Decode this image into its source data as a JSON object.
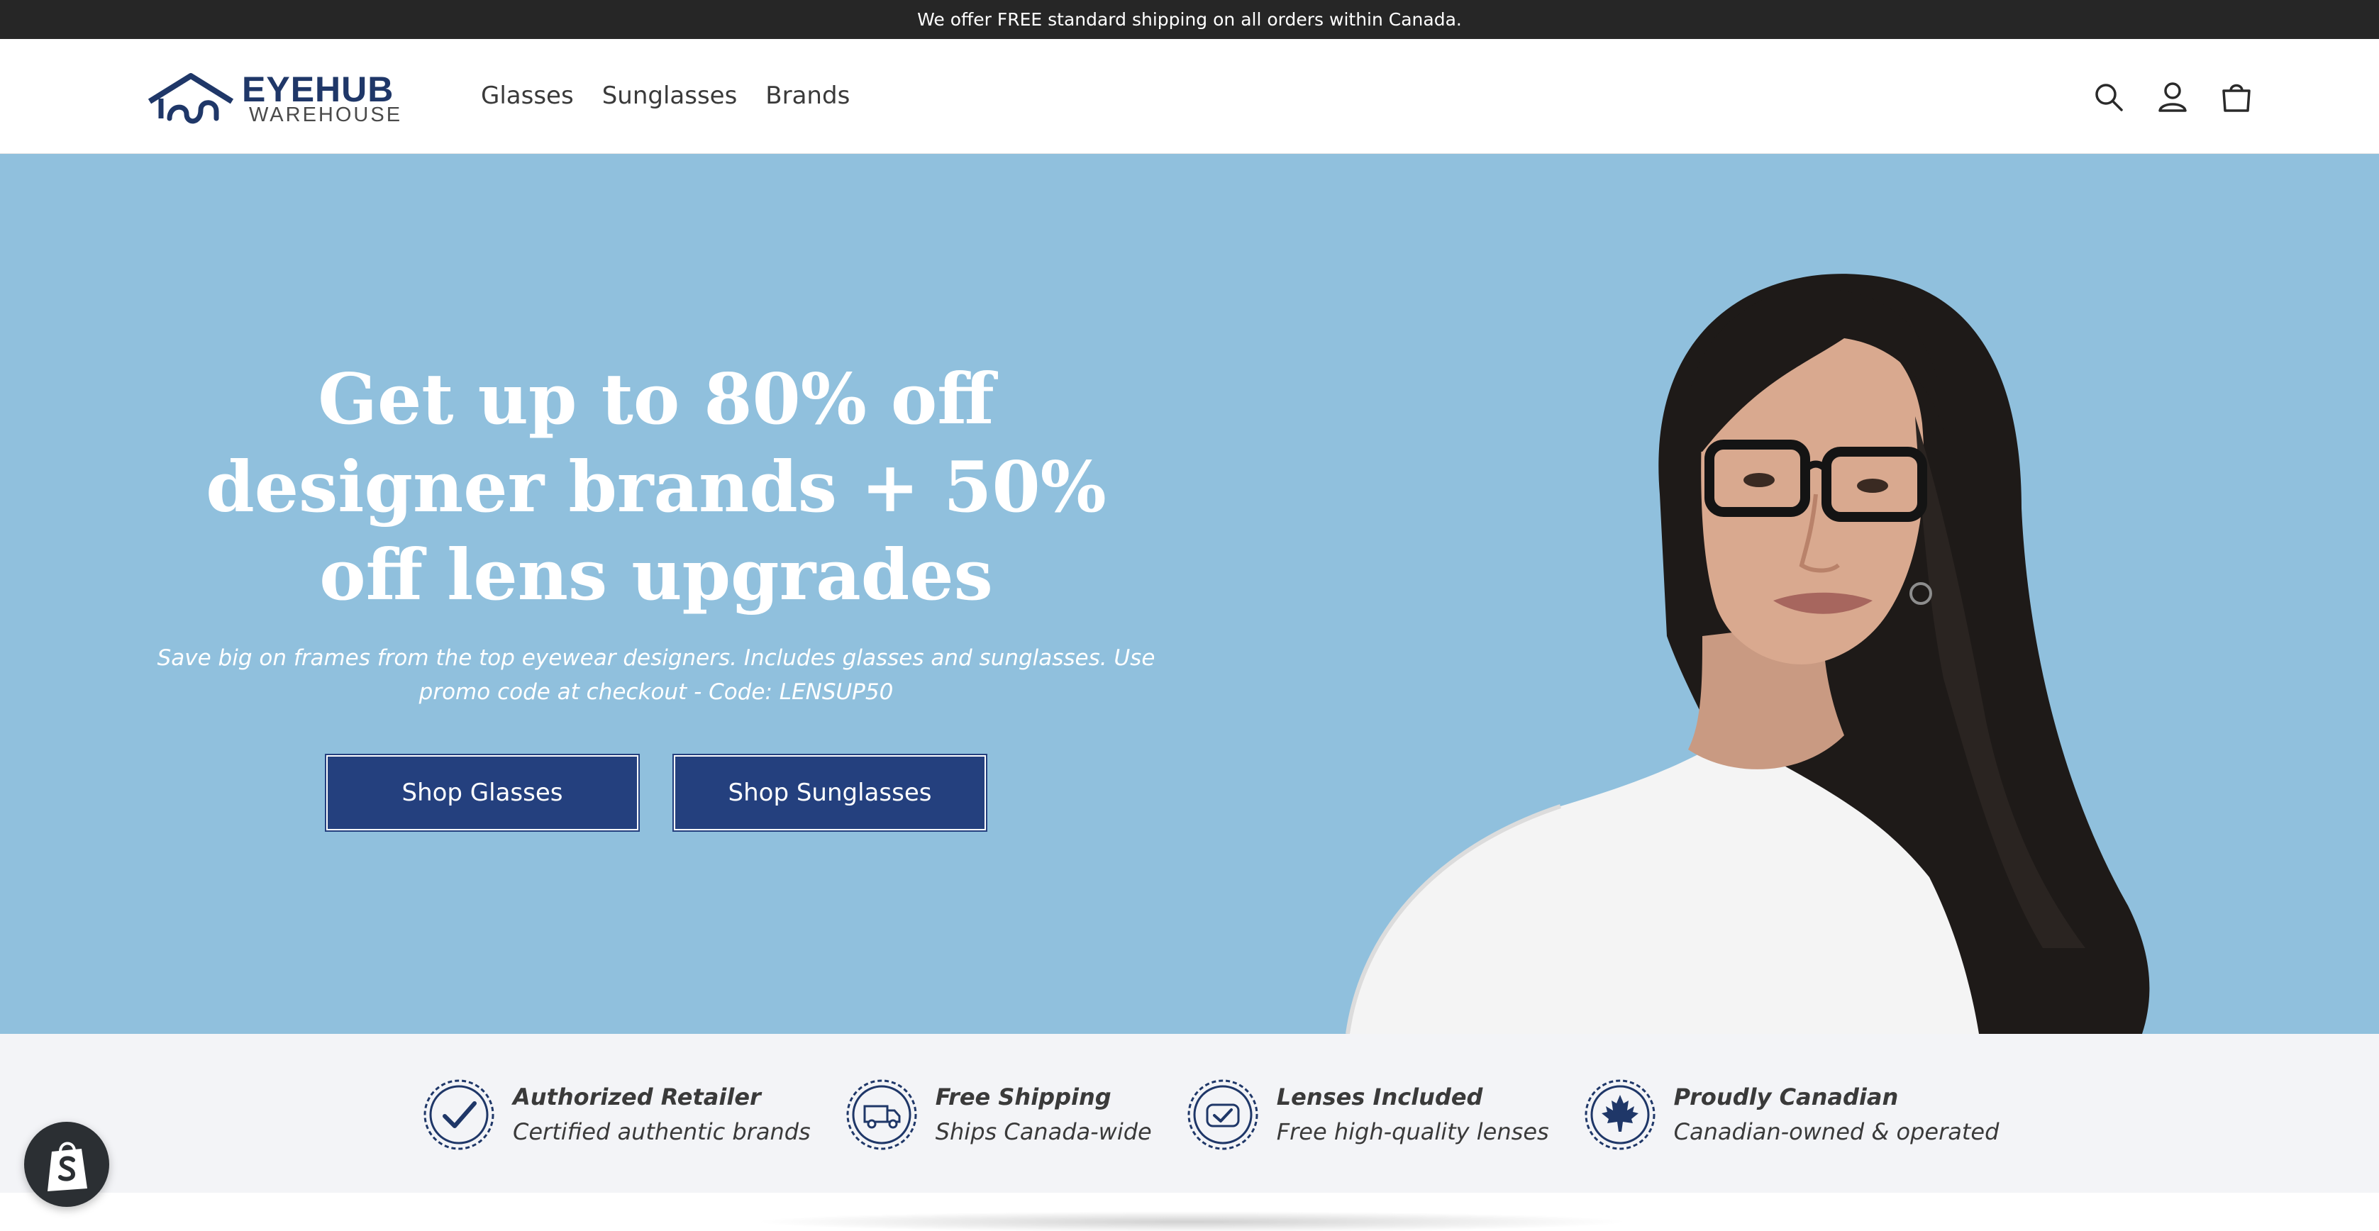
{
  "announcement": {
    "text": "We offer FREE standard shipping on all orders within Canada."
  },
  "brand": {
    "name_line1": "EYEHUB",
    "name_line2": "WAREHOUSE"
  },
  "nav": {
    "items": [
      "Glasses",
      "Sunglasses",
      "Brands"
    ]
  },
  "header_icons": [
    "search-icon",
    "account-icon",
    "cart-icon"
  ],
  "hero": {
    "title": "Get up to 80% off designer brands + 50% off lens upgrades",
    "subtitle": "Save big on frames from the top eyewear designers. Includes glasses and sunglasses. Use promo code at checkout - Code: LENSUP50",
    "buttons": [
      "Shop Glasses",
      "Shop Sunglasses"
    ],
    "background_color": "#90c0dd"
  },
  "trust_badges": [
    {
      "title": "Authorized Retailer",
      "desc": "Certified authentic brands",
      "icon": "checkmark-seal-icon"
    },
    {
      "title": "Free Shipping",
      "desc": "Ships Canada-wide",
      "icon": "truck-seal-icon"
    },
    {
      "title": "Lenses Included",
      "desc": "Free high-quality lenses",
      "icon": "lens-check-seal-icon"
    },
    {
      "title": "Proudly Canadian",
      "desc": "Canadian-owned & operated",
      "icon": "maple-leaf-seal-icon"
    }
  ],
  "colors": {
    "brand_navy": "#1f3768",
    "button_navy": "#24407e",
    "announcement_bg": "#262626",
    "strip_bg": "#f3f4f7"
  }
}
